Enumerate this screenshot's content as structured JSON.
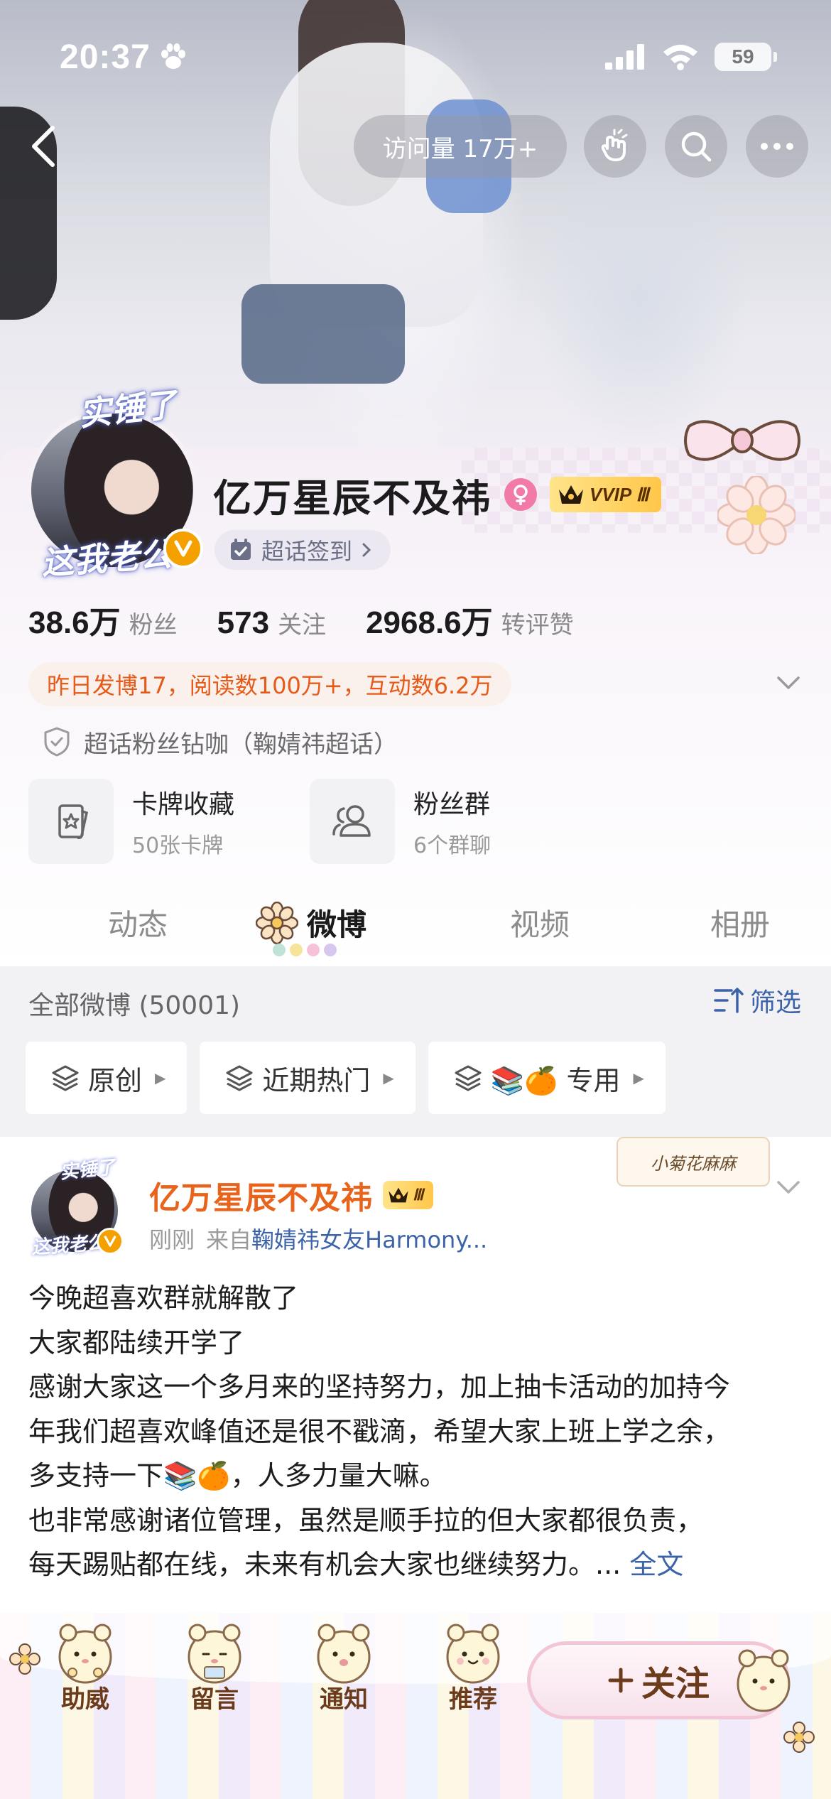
{
  "status_bar": {
    "time": "20:37",
    "battery": "59"
  },
  "top_nav": {
    "visits_label": "访问量 17万+"
  },
  "profile": {
    "avatar_text_top": "实锤了",
    "avatar_text_bottom": "这我老公",
    "name": "亿万星辰不及祎",
    "vip_badge": "VVIP Ⅲ",
    "super_topic_button": "超话签到",
    "stats": [
      {
        "value": "38.6万",
        "label": "粉丝"
      },
      {
        "value": "573",
        "label": "关注"
      },
      {
        "value": "2968.6万",
        "label": "转评赞"
      }
    ],
    "activity_summary": "昨日发博17，阅读数100万+，互动数6.2万",
    "fan_title": "超话粉丝钻咖（鞠婧祎超话）",
    "quick_cards": [
      {
        "title": "卡牌收藏",
        "subtitle": "50张卡牌",
        "icon": "card-icon"
      },
      {
        "title": "粉丝群",
        "subtitle": "6个群聊",
        "icon": "group-icon"
      }
    ]
  },
  "tabs": [
    {
      "label": "动态",
      "active": false
    },
    {
      "label": "微博",
      "active": true
    },
    {
      "label": "视频",
      "active": false
    },
    {
      "label": "相册",
      "active": false
    }
  ],
  "feed": {
    "all_label": "全部微博 (50001)",
    "filter_label": "筛选",
    "chips": [
      "原创",
      "近期热门",
      "📚🍊 专用"
    ]
  },
  "post": {
    "author": "亿万星辰不及祎",
    "vip_badge": "Ⅲ",
    "time": "刚刚",
    "source_prefix": "来自",
    "source": "鞠婧祎女友Harmony...",
    "sticker": "小菊花麻麻",
    "lines": [
      "今晚超喜欢群就解散了",
      "大家都陆续开学了",
      "感谢大家这一个多月来的坚持努力，加上抽卡活动的加持今",
      "年我们超喜欢峰值还是很不戳滴，希望大家上班上学之余，",
      "多支持一下📚🍊，人多力量大嘛。",
      "也非常感谢诸位管理，虽然是顺手拉的但大家都很负责，",
      "每天踢贴都在线，未来有机会大家也继续努力。..."
    ],
    "full_text_link": "全文"
  },
  "bottom_bar": {
    "actions": [
      "助威",
      "留言",
      "通知",
      "推荐"
    ],
    "follow_label": "关注"
  },
  "colors": {
    "accent_orange": "#e8641c",
    "link_blue": "#3c63a8",
    "vip_gold": "#ffc74a",
    "verified_orange": "#f4a100"
  }
}
